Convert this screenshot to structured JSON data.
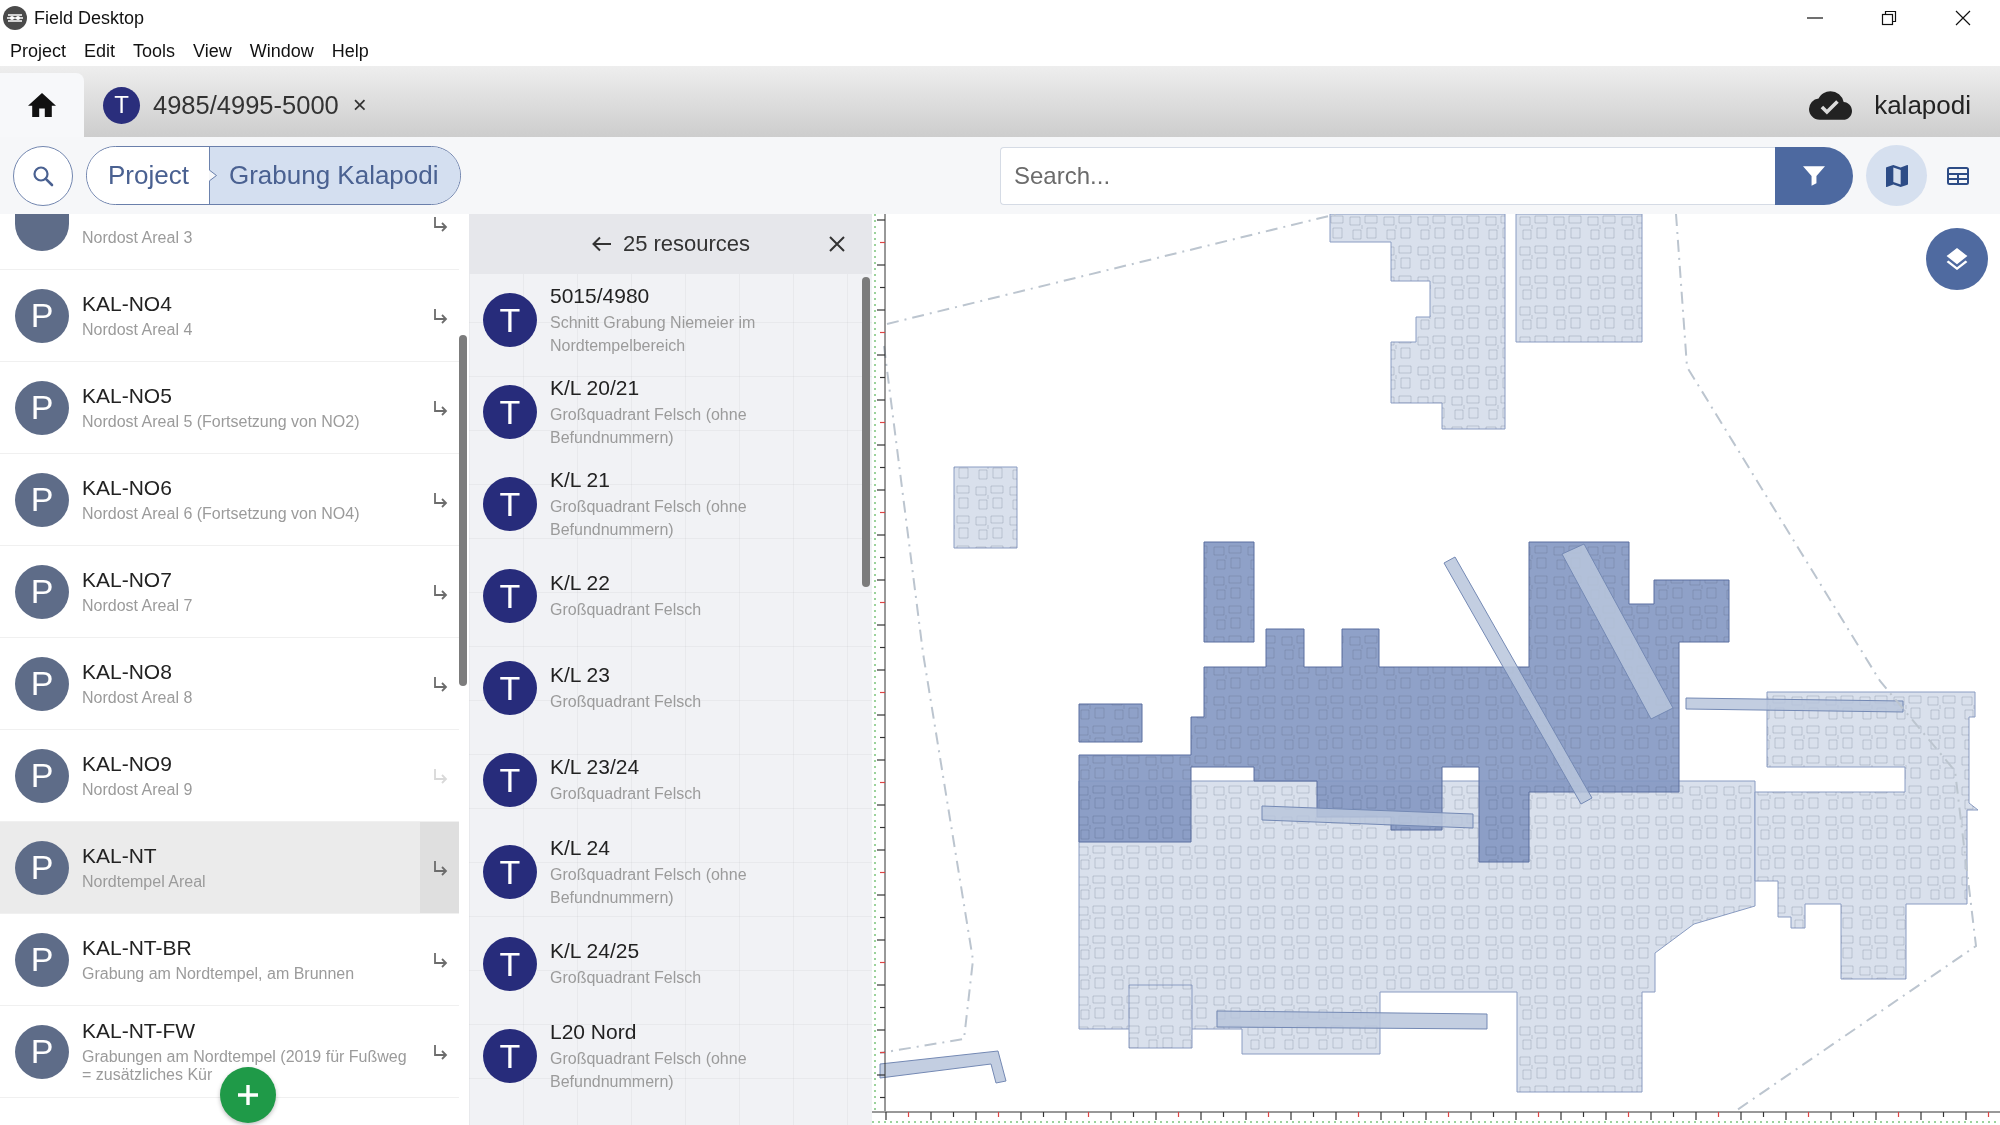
{
  "window": {
    "title": "Field Desktop"
  },
  "menu": [
    "Project",
    "Edit",
    "Tools",
    "View",
    "Window",
    "Help"
  ],
  "tabs": [
    {
      "kind": "home",
      "selected": true
    },
    {
      "kind": "resource",
      "avatar": "T",
      "label": "4985/4995-5000",
      "close": "×",
      "selected": false
    }
  ],
  "sync": {
    "label": "kalapodi"
  },
  "toolbar": {
    "breadcrumb": [
      {
        "label": "Project",
        "selected": false
      },
      {
        "label": "Grabung Kalapodi",
        "selected": true
      }
    ],
    "search": {
      "placeholder": "Search..."
    },
    "views": [
      {
        "kind": "map",
        "selected": true
      },
      {
        "kind": "table",
        "selected": false
      }
    ]
  },
  "overview_list": {
    "items": [
      {
        "subtitle": "Nordost Areal 3",
        "selected": false,
        "disabled": false
      },
      {
        "avatar": "P",
        "title": "KAL-NO4",
        "subtitle": "Nordost Areal 4",
        "selected": false,
        "disabled": false
      },
      {
        "avatar": "P",
        "title": "KAL-NO5",
        "subtitle": "Nordost Areal 5 (Fortsetzung von NO2)",
        "selected": false,
        "disabled": false
      },
      {
        "avatar": "P",
        "title": "KAL-NO6",
        "subtitle": "Nordost Areal 6 (Fortsetzung von NO4)",
        "selected": false,
        "disabled": false
      },
      {
        "avatar": "P",
        "title": "KAL-NO7",
        "subtitle": "Nordost Areal 7",
        "selected": false,
        "disabled": false
      },
      {
        "avatar": "P",
        "title": "KAL-NO8",
        "subtitle": "Nordost Areal 8",
        "selected": false,
        "disabled": false
      },
      {
        "avatar": "P",
        "title": "KAL-NO9",
        "subtitle": "Nordost Areal 9",
        "selected": false,
        "disabled": true
      },
      {
        "avatar": "P",
        "title": "KAL-NT",
        "subtitle": "Nordtempel Areal",
        "selected": true,
        "disabled": false
      },
      {
        "avatar": "P",
        "title": "KAL-NT-BR",
        "subtitle": "Grabung am Nordtempel, am Brunnen",
        "selected": false,
        "disabled": false
      },
      {
        "avatar": "P",
        "title": "KAL-NT-FW",
        "subtitle": "Grabungen am Nordtempel (2019 für Fußweg = zusätzliches Kür",
        "selected": false,
        "disabled": false
      }
    ]
  },
  "results_panel": {
    "title": "25 resources",
    "items": [
      {
        "avatar": "T",
        "title": "5015/4980",
        "subtitle": "Schnitt Grabung Niemeier im Nordtempelbereich"
      },
      {
        "avatar": "T",
        "title": "K/L 20/21",
        "subtitle": "Großquadrant Felsch (ohne Befundnummern)"
      },
      {
        "avatar": "T",
        "title": "K/L 21",
        "subtitle": "Großquadrant Felsch (ohne Befundnummern)"
      },
      {
        "avatar": "T",
        "title": "K/L 22",
        "subtitle": "Großquadrant Felsch"
      },
      {
        "avatar": "T",
        "title": "K/L 23",
        "subtitle": "Großquadrant Felsch"
      },
      {
        "avatar": "T",
        "title": "K/L 23/24",
        "subtitle": "Großquadrant Felsch"
      },
      {
        "avatar": "T",
        "title": "K/L 24",
        "subtitle": "Großquadrant Felsch (ohne Befundnummern)"
      },
      {
        "avatar": "T",
        "title": "K/L 24/25",
        "subtitle": "Großquadrant Felsch"
      },
      {
        "avatar": "T",
        "title": "L20 Nord",
        "subtitle": "Großquadrant Felsch (ohne Befundnummern)"
      }
    ]
  }
}
